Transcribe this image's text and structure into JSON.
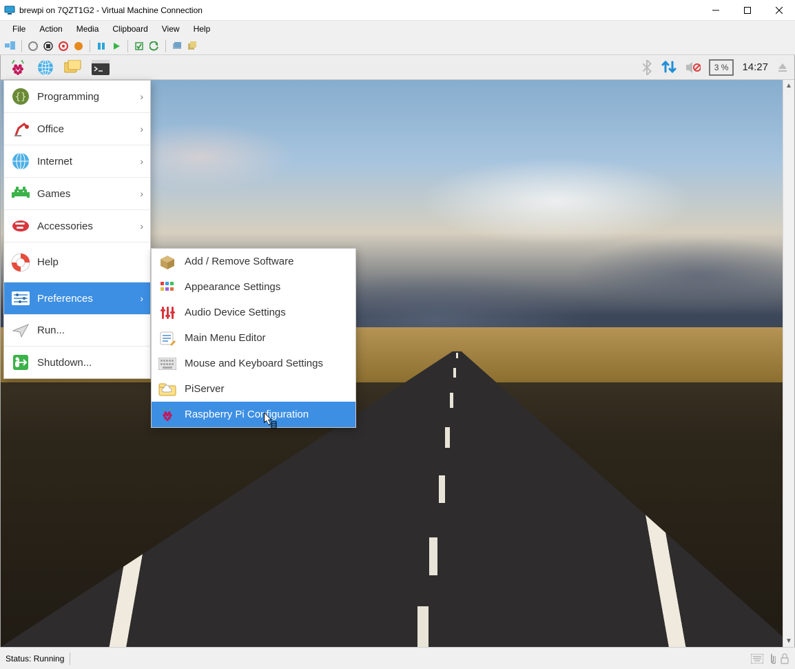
{
  "window": {
    "title": "brewpi on 7QZT1G2 - Virtual Machine Connection"
  },
  "menubar": {
    "items": [
      "File",
      "Action",
      "Media",
      "Clipboard",
      "View",
      "Help"
    ]
  },
  "statusbar": {
    "text": "Status: Running"
  },
  "rpi_panel": {
    "cpu_label": "3 %",
    "clock": "14:27"
  },
  "start_menu": {
    "items": [
      {
        "label": "Programming",
        "icon": "braces",
        "sub": true
      },
      {
        "label": "Office",
        "icon": "lamp",
        "sub": true
      },
      {
        "label": "Internet",
        "icon": "globe",
        "sub": true
      },
      {
        "label": "Games",
        "icon": "invader",
        "sub": true
      },
      {
        "label": "Accessories",
        "icon": "knife",
        "sub": true
      },
      {
        "label": "Help",
        "icon": "lifebuoy",
        "sub": false
      },
      {
        "label": "Preferences",
        "icon": "sliders",
        "sub": true,
        "selected": true
      },
      {
        "label": "Run...",
        "icon": "paperplane",
        "sub": false
      },
      {
        "label": "Shutdown...",
        "icon": "exit",
        "sub": false
      }
    ]
  },
  "submenu": {
    "items": [
      {
        "label": "Add / Remove Software",
        "icon": "box"
      },
      {
        "label": "Appearance Settings",
        "icon": "palette"
      },
      {
        "label": "Audio Device Settings",
        "icon": "sliders-red"
      },
      {
        "label": "Main Menu Editor",
        "icon": "editor"
      },
      {
        "label": "Mouse and Keyboard Settings",
        "icon": "keyboard"
      },
      {
        "label": "PiServer",
        "icon": "cloud"
      },
      {
        "label": "Raspberry Pi Configuration",
        "icon": "raspberry",
        "selected": true
      }
    ]
  }
}
